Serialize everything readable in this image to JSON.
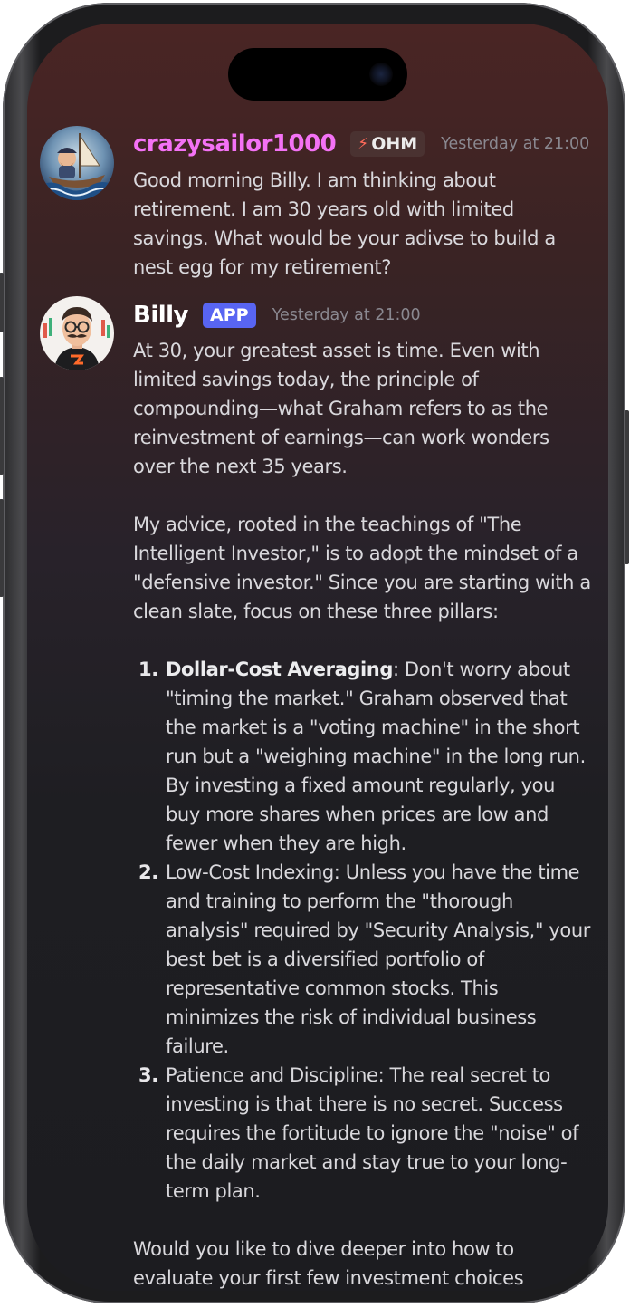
{
  "messages": [
    {
      "username": "crazysailor1000",
      "username_color": "#f472f5",
      "badge": "OHM",
      "badge_icon": "lightning-bolt-icon",
      "timestamp": "Yesterday at 21:00",
      "text": "Good morning Billy. I am thinking about retirement. I am 30 years old with limited savings. What would be your adivse to build a nest egg for my retirement?"
    },
    {
      "username": "Billy",
      "username_color": "#ffffff",
      "badge": "APP",
      "badge_color": "#5865f2",
      "timestamp": "Yesterday at 21:00",
      "intro": "At 30, your greatest asset is time. Even with limited savings today, the principle of compounding—what Graham refers to as the reinvestment of earnings—can work wonders over the next 35 years.",
      "advice": "My advice, rooted in the teachings of \"The Intelligent Investor,\" is to adopt the mindset of a \"defensive investor.\" Since you are starting with a clean slate, focus on these three pillars:",
      "pillars": [
        {
          "number": "1.",
          "title": "Dollar-Cost Averaging",
          "text": ": Don't worry about \"timing the market.\" Graham observed that the market is a \"voting machine\" in the short run but a \"weighing machine\" in the long run. By investing a fixed amount regularly, you buy more shares when prices are low and fewer when they are high."
        },
        {
          "number": "2.",
          "text": "Low-Cost Indexing: Unless you have the time and training to perform the \"thorough analysis\" required by \"Security Analysis,\" your best bet is a diversified portfolio of representative common stocks. This minimizes the risk of individual business failure."
        },
        {
          "number": "3.",
          "text": "Patience and Discipline: The real secret to investing is that there is no secret. Success requires the fortitude to ignore the \"noise\" of the daily market and stay true to your long-term plan."
        }
      ],
      "closing": "Would you like to dive deeper into how to evaluate your first few investment choices"
    }
  ]
}
